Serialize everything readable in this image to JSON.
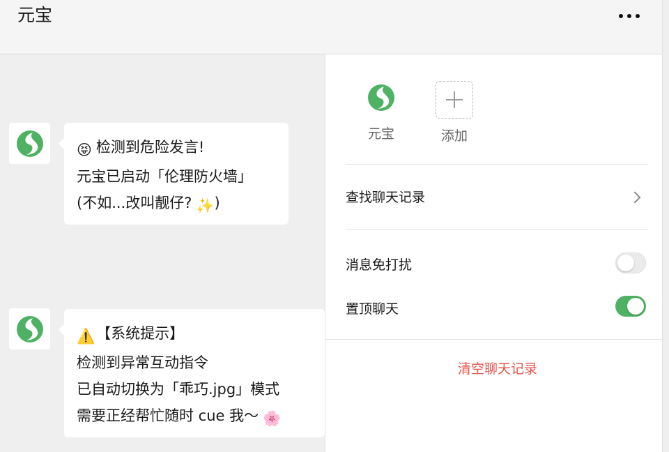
{
  "header": {
    "title": "元宝",
    "more_icon": "more-dots-icon"
  },
  "messages": [
    {
      "sender_icon": "yuanbao-logo-icon",
      "lines": [
        {
          "emoji": "😝",
          "text": "检测到危险发言!"
        },
        {
          "text": "元宝已启动「伦理防火墙」"
        },
        {
          "text": "(不如...改叫靓仔?",
          "emoji_after": "✨",
          "tail": ")"
        }
      ]
    },
    {
      "sender_icon": "yuanbao-logo-icon",
      "lines": [
        {
          "emoji": "⚠️",
          "text": "【系统提示】"
        },
        {
          "text": "检测到异常互动指令"
        },
        {
          "text": "已自动切换为「乖巧.jpg」模式"
        },
        {
          "text": "需要正经帮忙随时 cue 我～",
          "emoji_after": "🌸"
        }
      ]
    }
  ],
  "panel": {
    "members": [
      {
        "name": "元宝",
        "icon": "yuanbao-logo-icon"
      },
      {
        "name": "添加",
        "icon": "plus-icon"
      }
    ],
    "search_history": "查找聊天记录",
    "mute_label": "消息免打扰",
    "mute_enabled": false,
    "pin_label": "置顶聊天",
    "pin_enabled": true,
    "clear_history": "清空聊天记录"
  },
  "colors": {
    "accent_green": "#4fb163",
    "danger_red": "#e5534b"
  }
}
